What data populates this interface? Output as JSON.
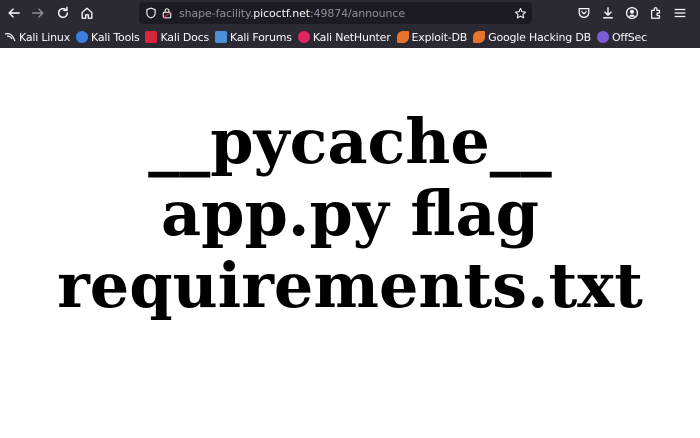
{
  "browser": {
    "url_host_prefix": "shape-facility.",
    "url_host": "picoctf.net",
    "url_rest": ":49874/announce",
    "icons": [
      "back-icon",
      "forward-icon",
      "reload-icon",
      "home-icon",
      "shield-icon",
      "lock-icon",
      "star-icon",
      "pocket-icon",
      "download-icon",
      "account-icon",
      "extensions-icon",
      "menu-icon"
    ],
    "bookmarks": [
      {
        "label": "Kali Linux",
        "icon": "kali-icon",
        "color": "#2b2a33"
      },
      {
        "label": "Kali Tools",
        "icon": "kali-tools-icon",
        "color": "#3d7de0"
      },
      {
        "label": "Kali Docs",
        "icon": "kali-docs-icon",
        "color": "#d7263d"
      },
      {
        "label": "Kali Forums",
        "icon": "kali-forums-icon",
        "color": "#4a90d9"
      },
      {
        "label": "Kali NetHunter",
        "icon": "nethunter-icon",
        "color": "#e0245e"
      },
      {
        "label": "Exploit-DB",
        "icon": "exploitdb-icon",
        "color": "#e8742c"
      },
      {
        "label": "Google Hacking DB",
        "icon": "ghdb-icon",
        "color": "#e8742c"
      },
      {
        "label": "OffSec",
        "icon": "offsec-icon",
        "color": "#7b5cd6"
      }
    ]
  },
  "page": {
    "lines": [
      "__pycache__",
      "app.py flag",
      "requirements.txt"
    ]
  }
}
